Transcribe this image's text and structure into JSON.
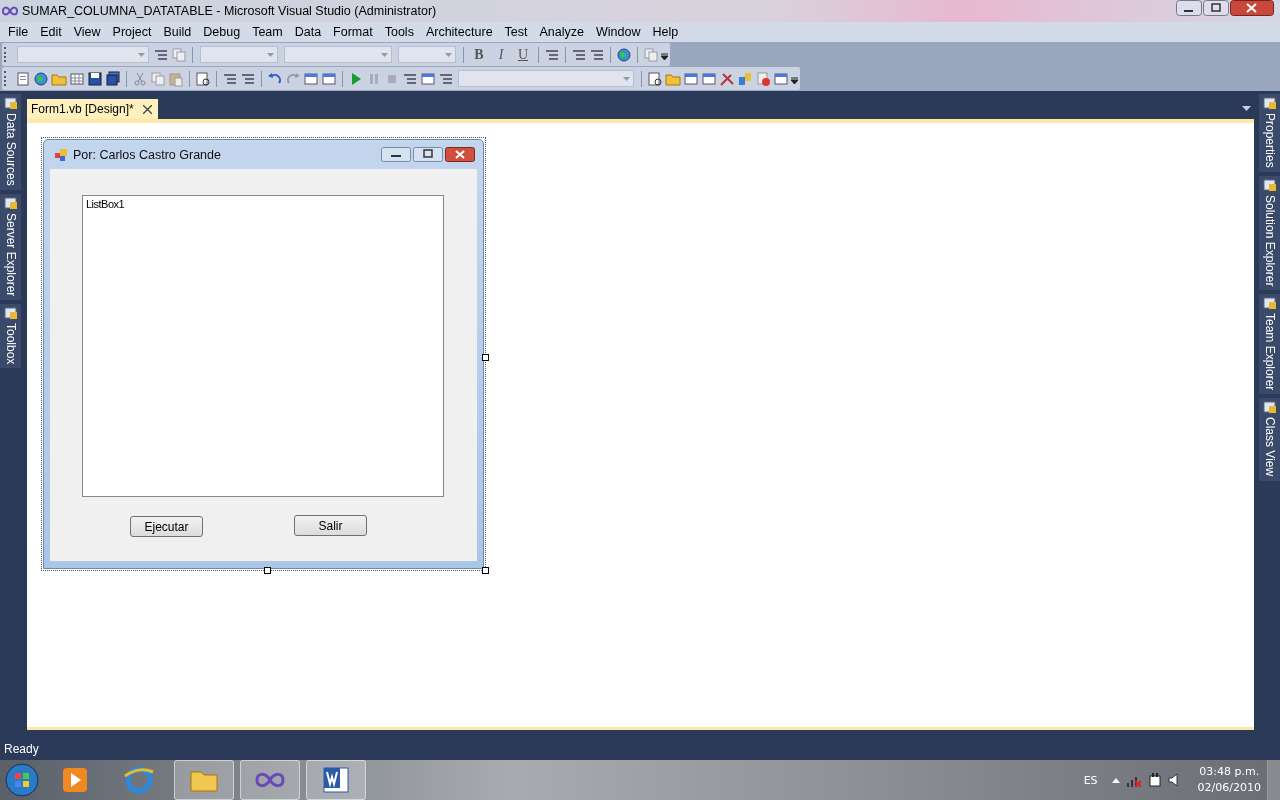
{
  "window": {
    "title": "SUMAR_COLUMNA_DATATABLE - Microsoft Visual Studio (Administrator)"
  },
  "menu": [
    "File",
    "Edit",
    "View",
    "Project",
    "Build",
    "Debug",
    "Team",
    "Data",
    "Format",
    "Tools",
    "Architecture",
    "Test",
    "Analyze",
    "Window",
    "Help"
  ],
  "format_toolbar": [
    "B",
    "I",
    "U"
  ],
  "tabs": [
    {
      "label": "Form1.vb [Design]*",
      "selected": true
    }
  ],
  "left_panels": [
    "Data Sources",
    "Server Explorer",
    "Toolbox"
  ],
  "right_panels": [
    "Properties",
    "Solution Explorer",
    "Team Explorer",
    "Class View"
  ],
  "form": {
    "title": "Por: Carlos Castro Grande",
    "listbox_items": [
      "ListBox1"
    ],
    "buttons": [
      "Ejecutar",
      "Salir"
    ]
  },
  "status_bar": "Ready",
  "taskbar": {
    "language": "ES",
    "time": "03:48 p.m.",
    "date": "02/06/2010"
  }
}
